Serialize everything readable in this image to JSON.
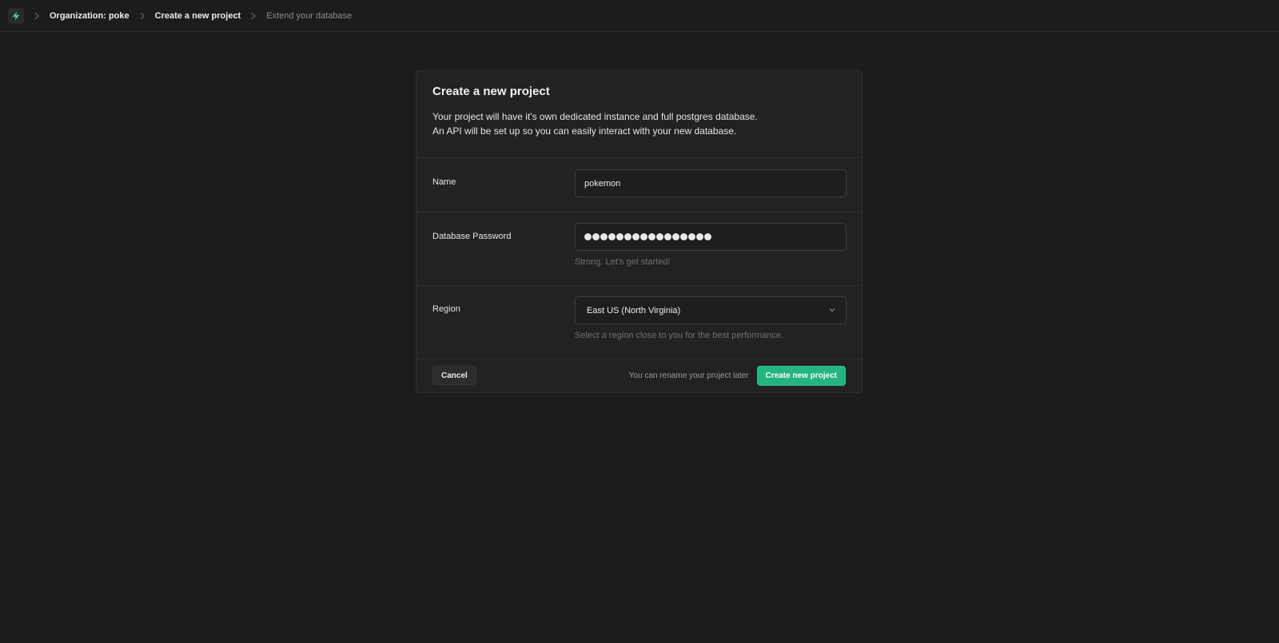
{
  "breadcrumb": {
    "items": [
      "Organization: poke",
      "Create a new project",
      "Extend your database"
    ]
  },
  "icons": {
    "logo": "bolt-icon",
    "separator": "chevron-right-icon",
    "select": "chevron-down-icon"
  },
  "colors": {
    "accent": "#24b47e",
    "background": "#1c1c1c",
    "card": "#222222"
  },
  "card": {
    "title": "Create a new project",
    "description_line1": "Your project will have it's own dedicated instance and full postgres database.",
    "description_line2": "An API will be set up so you can easily interact with your new database."
  },
  "form": {
    "name": {
      "label": "Name",
      "value": "pokemon"
    },
    "password": {
      "label": "Database Password",
      "masked_length": 16,
      "hint": "Strong. Let's get started!"
    },
    "region": {
      "label": "Region",
      "value": "East US (North Virginia)",
      "hint": "Select a region close to you for the best performance."
    }
  },
  "footer": {
    "cancel_label": "Cancel",
    "note": "You can rename your project later",
    "create_label": "Create new project"
  }
}
